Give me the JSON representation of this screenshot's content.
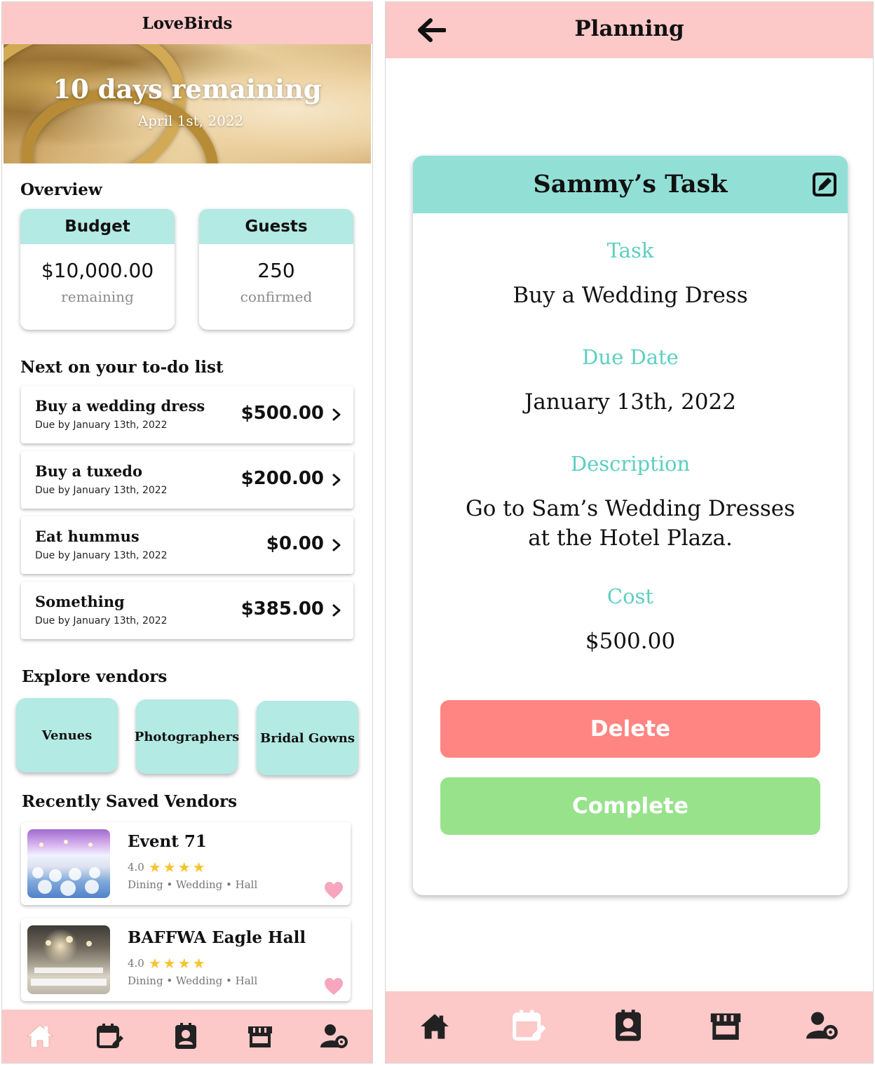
{
  "left": {
    "app_title": "LoveBirds",
    "hero": {
      "title": "10 days remaining",
      "date": "April 1st, 2022"
    },
    "overview": {
      "heading": "Overview",
      "budget": {
        "label": "Budget",
        "value": "$10,000.00",
        "sub": "remaining"
      },
      "guests": {
        "label": "Guests",
        "value": "250",
        "sub": "confirmed"
      }
    },
    "todo": {
      "heading": "Next on your to-do list",
      "items": [
        {
          "title": "Buy a wedding dress",
          "due": "Due by January 13th, 2022",
          "cost": "$500.00"
        },
        {
          "title": "Buy a tuxedo",
          "due": "Due by January 13th, 2022",
          "cost": "$200.00"
        },
        {
          "title": "Eat hummus",
          "due": "Due by January 13th, 2022",
          "cost": "$0.00"
        },
        {
          "title": "Something",
          "due": "Due by January 13th, 2022",
          "cost": "$385.00"
        }
      ]
    },
    "explore": {
      "heading": "Explore vendors",
      "categories": [
        "Venues",
        "Photographers",
        "Bridal Gowns"
      ]
    },
    "saved": {
      "heading": "Recently Saved Vendors",
      "vendors": [
        {
          "name": "Event 71",
          "rating": "4.0",
          "stars": "★★★★",
          "tags": "Dining • Wedding • Hall"
        },
        {
          "name": "BAFFWA Eagle Hall",
          "rating": "4.0",
          "stars": "★★★★",
          "tags": "Dining • Wedding • Hall"
        }
      ]
    },
    "nav_icons": [
      "home-icon",
      "calendar-edit-icon",
      "contact-card-icon",
      "store-icon",
      "user-settings-icon"
    ]
  },
  "right": {
    "screen_title": "Planning",
    "card_title": "Sammy’s Task",
    "task_label": "Task",
    "task_value": "Buy a Wedding Dress",
    "due_label": "Due Date",
    "due_value": "January 13th, 2022",
    "desc_label": "Description",
    "desc_line1": "Go to Sam’s Wedding Dresses",
    "desc_line2": "at the Hotel Plaza.",
    "cost_label": "Cost",
    "cost_value": "$500.00",
    "delete_label": "Delete",
    "complete_label": "Complete",
    "nav_icons": [
      "home-icon",
      "calendar-edit-icon",
      "contact-card-icon",
      "store-icon",
      "user-settings-icon"
    ]
  },
  "colors": {
    "header_pink": "#fcc8c8",
    "teal_light": "#b3eae3",
    "teal_header": "#92dfd6",
    "teal_label": "#5ccfc0",
    "delete_red": "#ff8582",
    "complete_green": "#98e28c",
    "star_gold": "#f4c430",
    "heart_pink": "#f7a6bd"
  }
}
